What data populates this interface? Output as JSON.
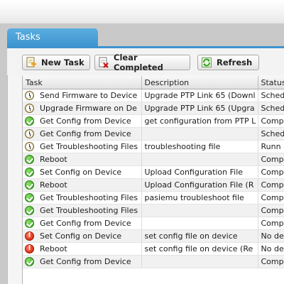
{
  "panel": {
    "tab_label": "Tasks"
  },
  "toolbar": {
    "new_task_label": "New Task",
    "clear_completed_label": "Clear Completed",
    "refresh_label": "Refresh"
  },
  "grid": {
    "columns": [
      "Task",
      "Description",
      "Status"
    ],
    "rows": [
      {
        "status_icon": "scheduled-icon",
        "task": "Send Firmware to Device",
        "description": "Upgrade PTP Link 65 (Downl",
        "status": "Sched"
      },
      {
        "status_icon": "scheduled-icon",
        "task": "Upgrade Firmware on De",
        "description": "Upgrade PTP Link 65 (Upgra",
        "status": "Sched"
      },
      {
        "status_icon": "complete-icon",
        "task": "Get Config from Device",
        "description": "get configuration from PTP L",
        "status": "Comp"
      },
      {
        "status_icon": "scheduled-icon",
        "task": "Get Config from Device",
        "description": "",
        "status": "Sched"
      },
      {
        "status_icon": "scheduled-icon",
        "task": "Get Troubleshooting Files",
        "description": "troubleshooting file",
        "status": "Runn"
      },
      {
        "status_icon": "complete-icon",
        "task": "Reboot",
        "description": "",
        "status": "Comp"
      },
      {
        "status_icon": "complete-icon",
        "task": "Set Config on Device",
        "description": "Upload Configuration File",
        "status": "Comp"
      },
      {
        "status_icon": "complete-icon",
        "task": "Reboot",
        "description": "Upload Configuration File (R",
        "status": "Comp"
      },
      {
        "status_icon": "complete-icon",
        "task": "Get Troubleshooting Files",
        "description": "pasiemu troubleshoot file",
        "status": "Comp"
      },
      {
        "status_icon": "complete-icon",
        "task": "Get Troubleshooting Files",
        "description": "",
        "status": "Comp"
      },
      {
        "status_icon": "complete-icon",
        "task": "Get Config from Device",
        "description": "",
        "status": "Comp"
      },
      {
        "status_icon": "error-icon",
        "task": "Set Config on Device",
        "description": "set config file on device",
        "status": "No de"
      },
      {
        "status_icon": "error-icon",
        "task": "Reboot",
        "description": "set config file on device (Re",
        "status": "No de"
      },
      {
        "status_icon": "complete-icon",
        "task": "Get Config from Device",
        "description": "",
        "status": "Comp"
      }
    ]
  },
  "colors": {
    "tab_blue": "#3d93cf",
    "complete_green": "#2f9b1c",
    "error_red": "#cc1500"
  }
}
